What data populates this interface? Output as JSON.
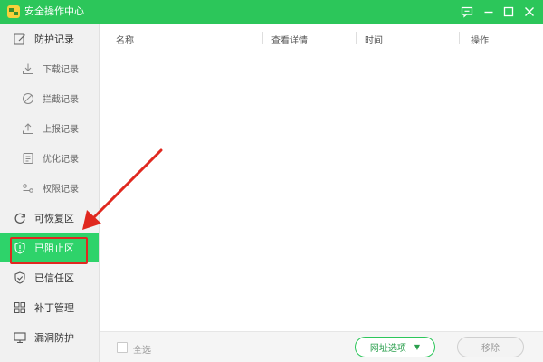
{
  "app": {
    "title": "安全操作中心",
    "colors": {
      "accent": "#2cc65a",
      "active_item": "#2ed36a",
      "annotation": "#e0281f"
    }
  },
  "window_controls": [
    {
      "name": "feedback-icon"
    },
    {
      "name": "minimize-icon"
    },
    {
      "name": "maximize-icon"
    },
    {
      "name": "close-icon"
    }
  ],
  "sidebar": {
    "items": [
      {
        "label": "防护记录",
        "icon": "edit-icon",
        "level": "top",
        "active": false
      },
      {
        "label": "下载记录",
        "icon": "download-icon",
        "level": "sub",
        "active": false
      },
      {
        "label": "拦截记录",
        "icon": "block-icon",
        "level": "sub",
        "active": false
      },
      {
        "label": "上报记录",
        "icon": "upload-icon",
        "level": "sub",
        "active": false
      },
      {
        "label": "优化记录",
        "icon": "optimize-icon",
        "level": "sub",
        "active": false
      },
      {
        "label": "权限记录",
        "icon": "permission-icon",
        "level": "sub",
        "active": false
      },
      {
        "label": "可恢复区",
        "icon": "restore-icon",
        "level": "top",
        "active": false
      },
      {
        "label": "已阻止区",
        "icon": "shield-blocked-icon",
        "level": "top",
        "active": true
      },
      {
        "label": "已信任区",
        "icon": "shield-check-icon",
        "level": "top",
        "active": false
      },
      {
        "label": "补丁管理",
        "icon": "patch-icon",
        "level": "top",
        "active": false
      },
      {
        "label": "漏洞防护",
        "icon": "vulnerability-icon",
        "level": "top",
        "active": false
      }
    ]
  },
  "table": {
    "columns": [
      "名称",
      "查看详情",
      "时间",
      "操作"
    ],
    "rows": []
  },
  "footer": {
    "select_all_label": "全选",
    "url_options_label": "网址选项",
    "remove_label": "移除"
  }
}
